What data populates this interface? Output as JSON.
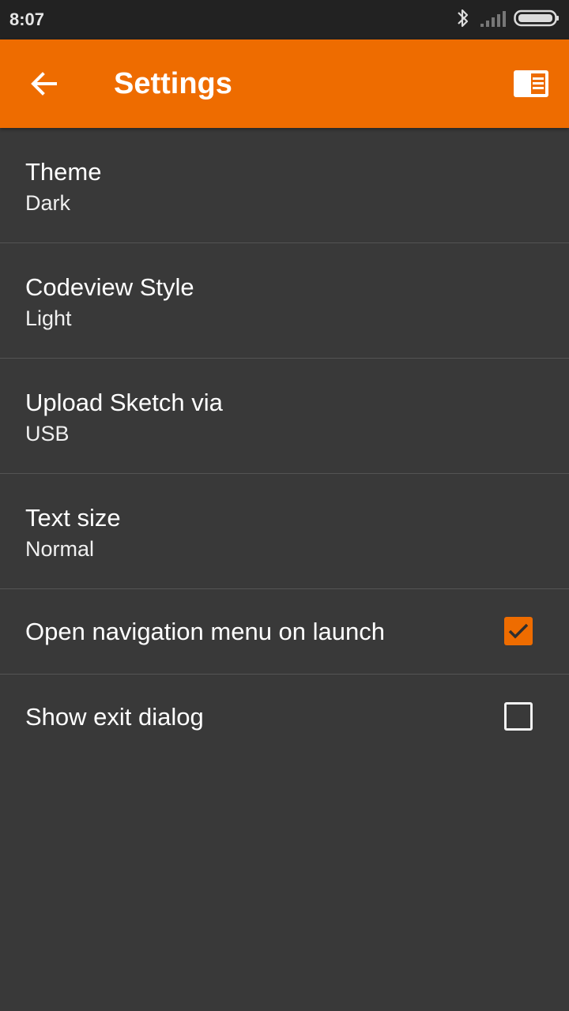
{
  "status_bar": {
    "time": "8:07",
    "icons": [
      "bluetooth-icon",
      "signal-icon",
      "battery-icon"
    ]
  },
  "app_bar": {
    "title": "Settings",
    "back_icon": "arrow-left-icon",
    "action_icon": "side-panel-icon",
    "color": "#ee6c00"
  },
  "settings": [
    {
      "title": "Theme",
      "value": "Dark"
    },
    {
      "title": "Codeview Style",
      "value": "Light"
    },
    {
      "title": "Upload Sketch via",
      "value": "USB"
    },
    {
      "title": "Text size",
      "value": "Normal"
    }
  ],
  "toggles": [
    {
      "title": "Open navigation menu on launch",
      "checked": true
    },
    {
      "title": "Show exit dialog",
      "checked": false
    }
  ],
  "colors": {
    "background": "#393939",
    "divider": "#545454",
    "accent": "#ee6c00"
  }
}
